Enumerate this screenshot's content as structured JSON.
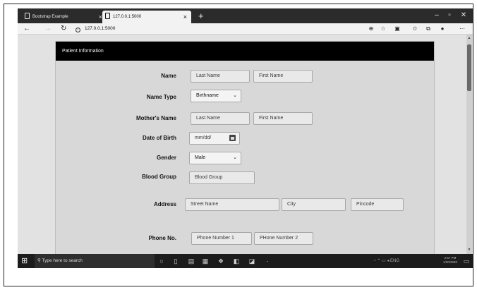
{
  "browser": {
    "tabs": [
      {
        "title": "Bootstrap Example"
      },
      {
        "title": "127.0.0.1:5000"
      }
    ],
    "url": "127.0.0.1:5000",
    "tab_close_glyph": "×",
    "new_tab_glyph": "+"
  },
  "form": {
    "header": "Patient Information",
    "name": {
      "label": "Name",
      "last_placeholder": "Last Name",
      "first_placeholder": "First Name"
    },
    "name_type": {
      "label": "Name Type",
      "selected": "Birthname"
    },
    "mothers_name": {
      "label": "Mother's Name",
      "last_placeholder": "Last Name",
      "first_placeholder": "First Name"
    },
    "dob": {
      "label": "Date of Birth",
      "placeholder": "mm/dd/"
    },
    "gender": {
      "label": "Gender",
      "selected": "Male"
    },
    "blood_group": {
      "label": "Blood Group",
      "placeholder": "Blood Group"
    },
    "address": {
      "label": "Address",
      "street_placeholder": "Street Name",
      "city_placeholder": "City",
      "pincode_placeholder": "Pincode"
    },
    "phone": {
      "label": "Phone No.",
      "phone1_placeholder": "Phone Number 1",
      "phone2_placeholder": "PHone Number 2"
    }
  },
  "taskbar": {
    "search_placeholder": "Type here to search",
    "time": "2:57 PM",
    "date": "1/30/2020"
  },
  "icons": {
    "back": "back-arrow-icon",
    "forward": "forward-arrow-icon",
    "refresh": "refresh-icon",
    "zoom": "zoom-icon",
    "favorite": "star-icon",
    "reading": "reading-view-icon",
    "favorites_bar": "favorites-icon",
    "collections": "collections-icon",
    "profile": "profile-icon",
    "more": "more-icon"
  }
}
